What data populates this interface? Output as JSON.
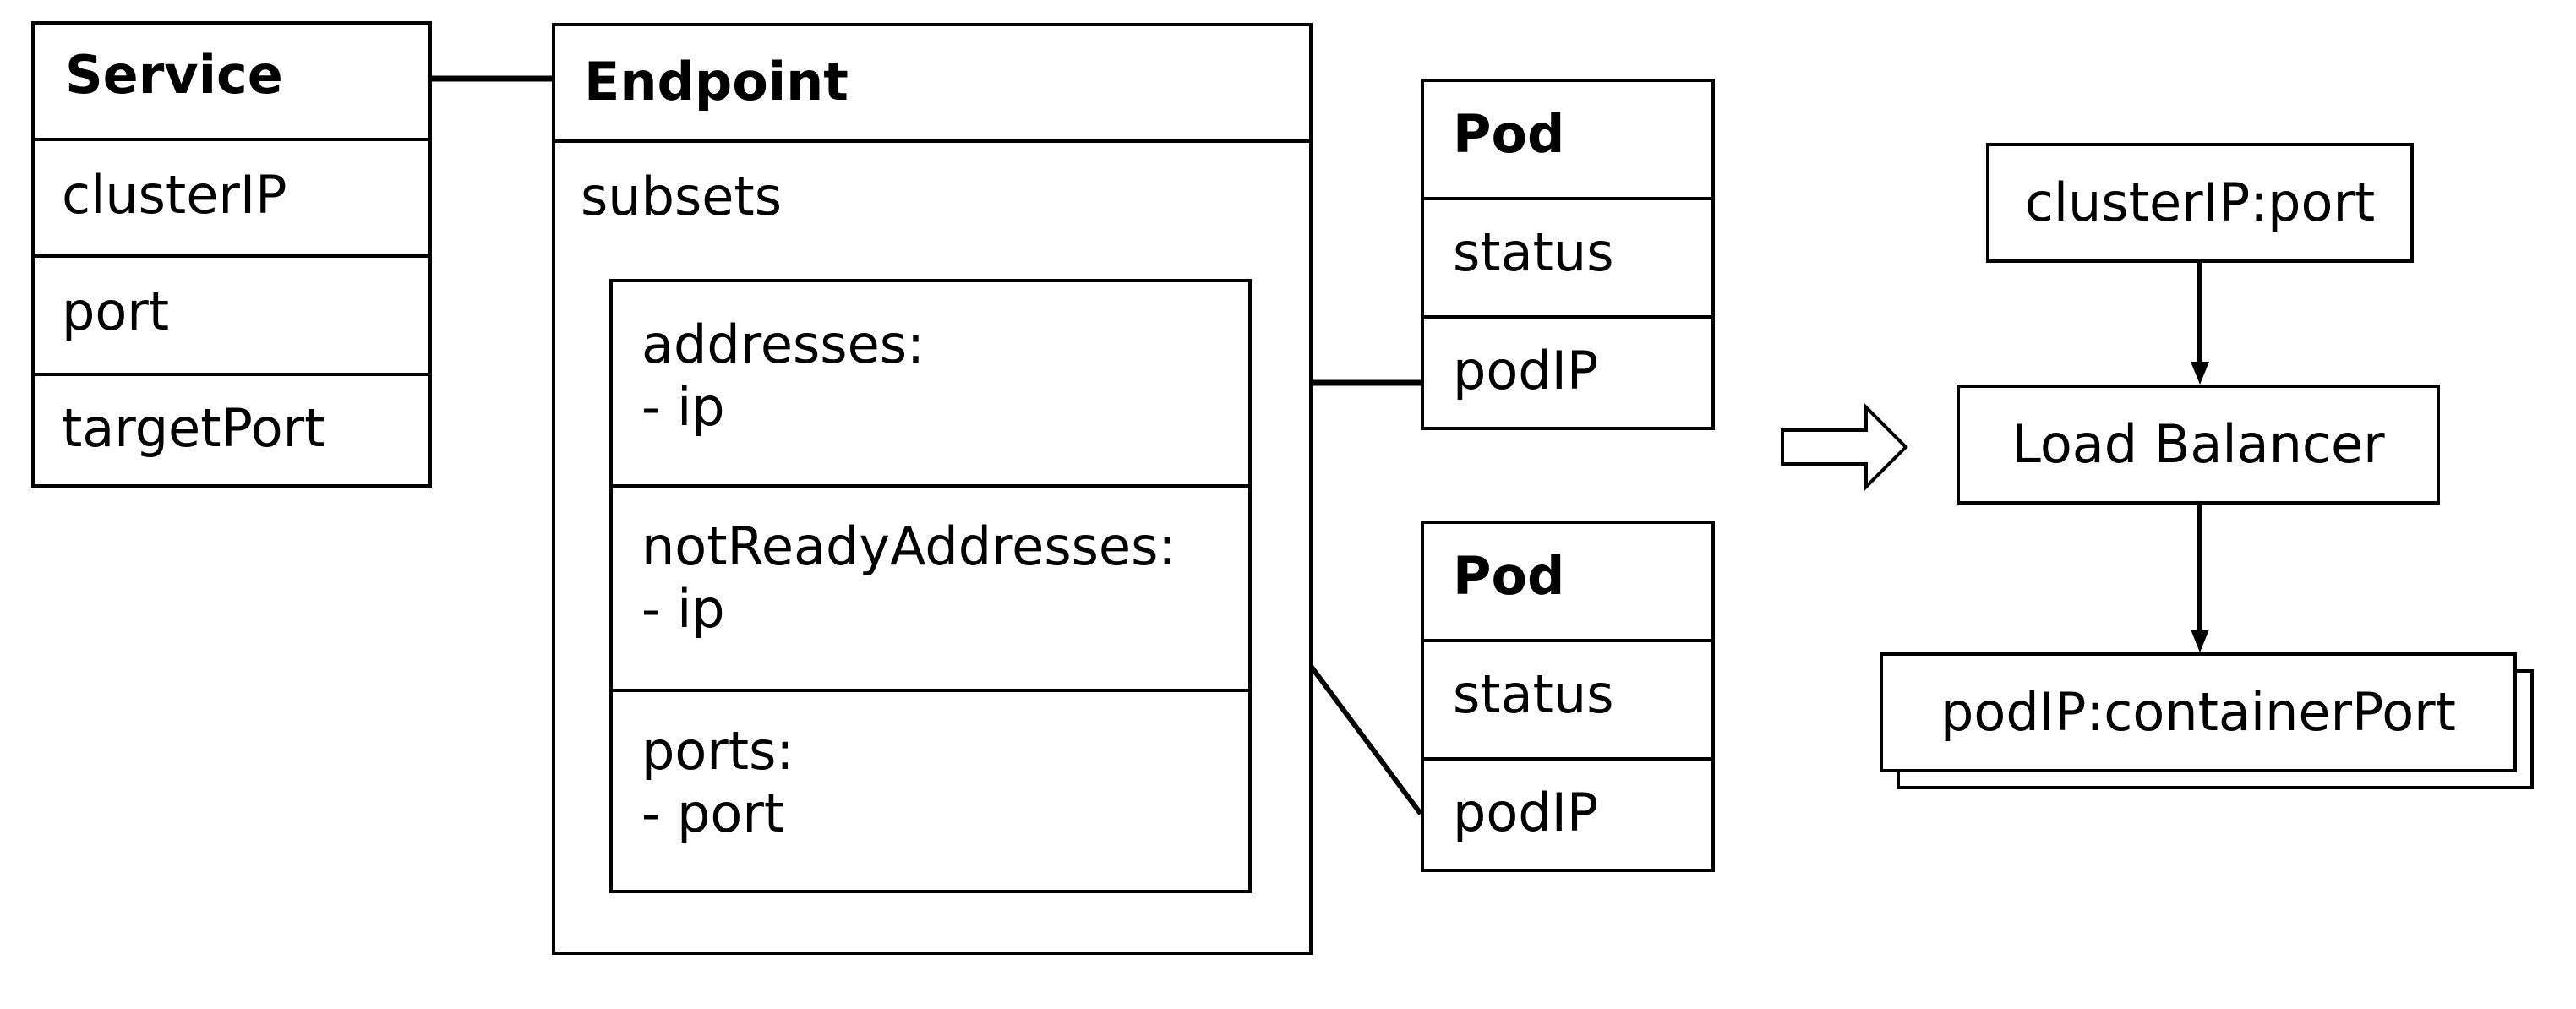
{
  "service": {
    "title": "Service",
    "fields": [
      "clusterIP",
      "port",
      "targetPort"
    ]
  },
  "endpoint": {
    "title": "Endpoint",
    "subsets_label": "subsets",
    "subset_rows": [
      {
        "line1": "addresses:",
        "line2": "- ip"
      },
      {
        "line1": "notReadyAddresses:",
        "line2": "- ip"
      },
      {
        "line1": "ports:",
        "line2": "- port"
      }
    ]
  },
  "pods": [
    {
      "title": "Pod",
      "fields": [
        "status",
        "podIP"
      ]
    },
    {
      "title": "Pod",
      "fields": [
        "status",
        "podIP"
      ]
    }
  ],
  "flow": {
    "source": "clusterIP:port",
    "balancer": "Load Balancer",
    "target": "podIP:containerPort"
  }
}
